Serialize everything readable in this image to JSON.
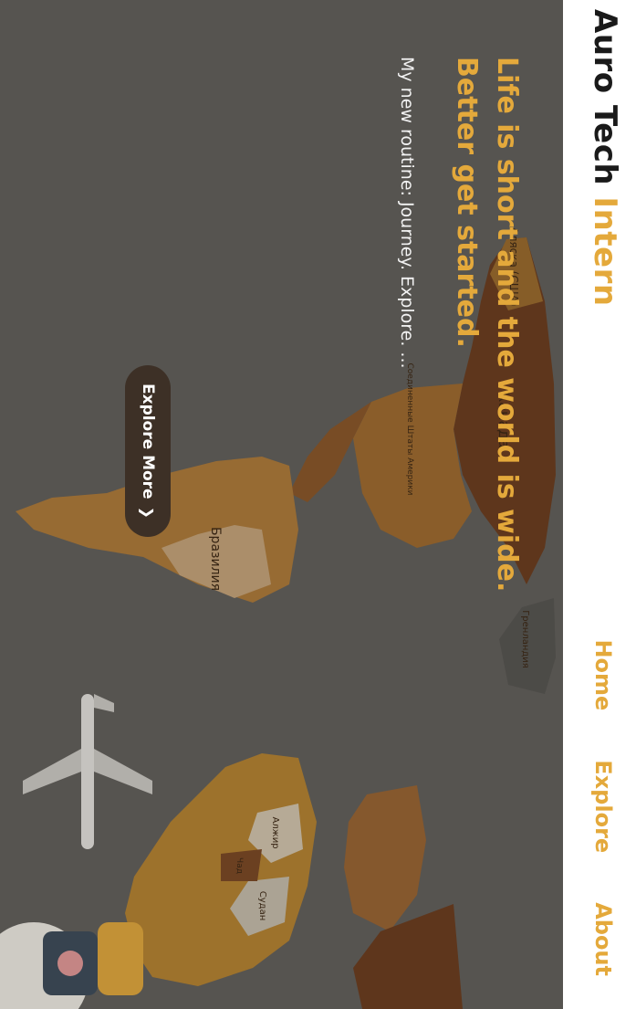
{
  "brand": {
    "main": "Auro Tech",
    "accent": "Intern"
  },
  "nav": {
    "home": "Home",
    "explore": "Explore",
    "about": "About"
  },
  "hero": {
    "headline": "Life is short and the world is wide. Better get started.",
    "tagline": "My new routine: Journey. Explore. ...",
    "cta_label": "Explore More",
    "cta_icon": "chevron-right-icon"
  },
  "map_labels": {
    "alaska": "Аляска (США)",
    "canada": "Канада",
    "usa": "Соединенные Штаты Америки",
    "greenland": "Гренландия",
    "brazil": "Бразилия",
    "algeria": "Алжир",
    "sudan": "Судан",
    "chad": "Чад"
  },
  "colors": {
    "accent": "#e4a93b",
    "button_bg": "#3d3026",
    "navbar_bg": "#ffffff",
    "hero_bg": "#615e5b"
  }
}
